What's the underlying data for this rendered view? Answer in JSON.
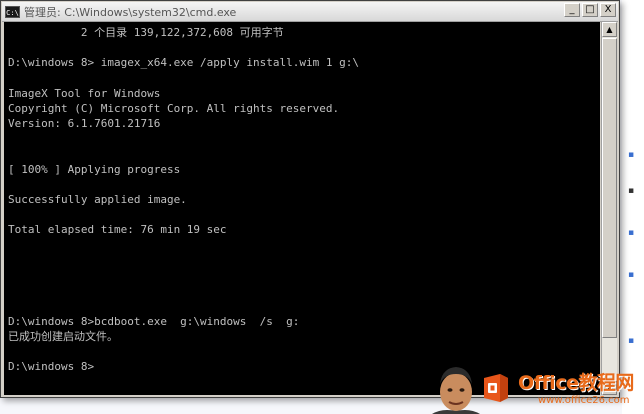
{
  "window": {
    "icon_label": "C:\\",
    "title": "管理员: C:\\Windows\\system32\\cmd.exe",
    "minimize_glyph": "_",
    "maximize_glyph": "□",
    "close_glyph": "X"
  },
  "console": {
    "text_color": "#c0c0c0",
    "background": "#000000",
    "lines": [
      "           2 个目录 139,122,372,608 可用字节",
      "",
      "D:\\windows 8> imagex_x64.exe /apply install.wim 1 g:\\",
      "",
      "ImageX Tool for Windows",
      "Copyright (C) Microsoft Corp. All rights reserved.",
      "Version: 6.1.7601.21716",
      "",
      "",
      "[ 100% ] Applying progress",
      "",
      "Successfully applied image.",
      "",
      "Total elapsed time: 76 min 19 sec",
      "",
      "",
      "",
      "",
      "",
      "D:\\windows 8>bcdboot.exe  g:\\windows  /s  g:",
      "已成功创建启动文件。",
      "",
      "D:\\windows 8>"
    ]
  },
  "scrollbar": {
    "up_glyph": "▲",
    "down_glyph": "▼"
  },
  "watermark": {
    "brand_text": "Office教程网",
    "url": "www.office26.com",
    "brand_color": "#e86a1a"
  }
}
